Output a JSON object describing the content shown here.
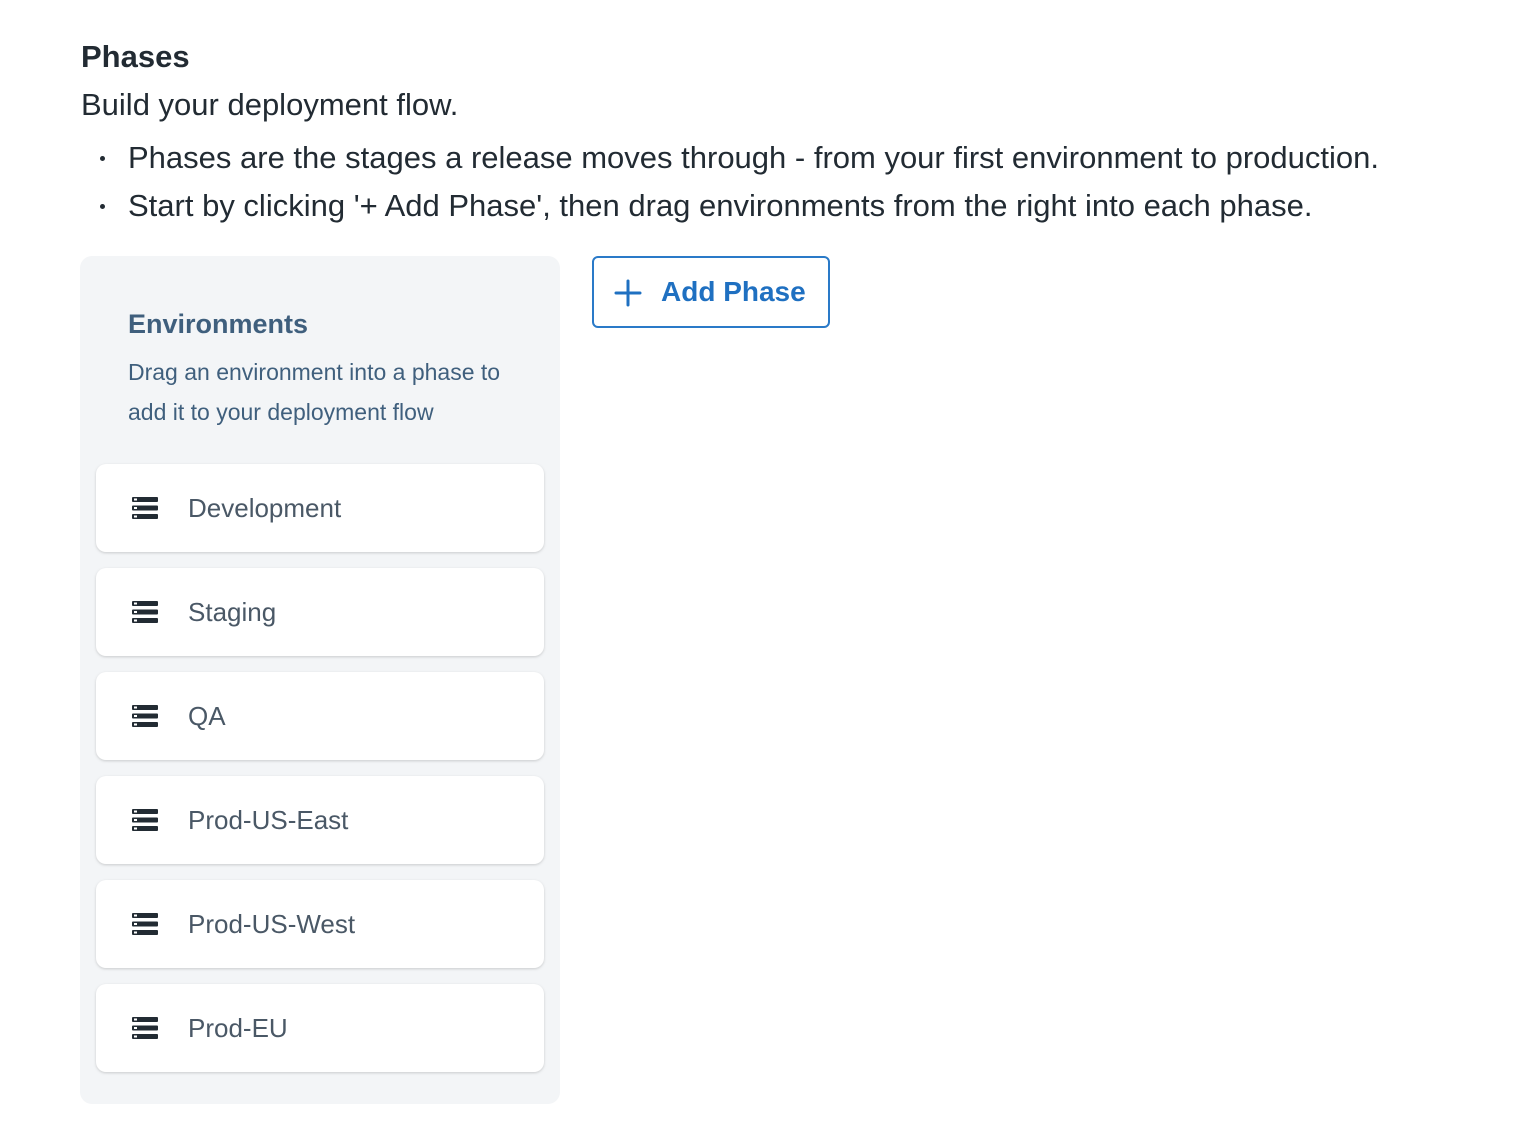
{
  "header": {
    "title": "Phases",
    "subtitle": "Build your deployment flow.",
    "bullets": [
      "Phases are the stages a release moves through - from your first environment to production.",
      "Start by clicking '+ Add Phase', then drag environments from the right into each phase."
    ]
  },
  "environments_panel": {
    "title": "Environments",
    "description": "Drag an environment into a phase to add it to your deployment flow",
    "items": [
      {
        "label": "Development",
        "icon": "server-icon"
      },
      {
        "label": "Staging",
        "icon": "server-icon"
      },
      {
        "label": "QA",
        "icon": "server-icon"
      },
      {
        "label": "Prod-US-East",
        "icon": "server-icon"
      },
      {
        "label": "Prod-US-West",
        "icon": "server-icon"
      },
      {
        "label": "Prod-EU",
        "icon": "server-icon"
      }
    ]
  },
  "toolbar": {
    "add_phase_label": "Add Phase",
    "add_phase_icon": "plus-icon"
  },
  "colors": {
    "accent": "#1f70c1",
    "panel_background": "#f3f5f7",
    "panel_text": "#3f5f7d"
  }
}
